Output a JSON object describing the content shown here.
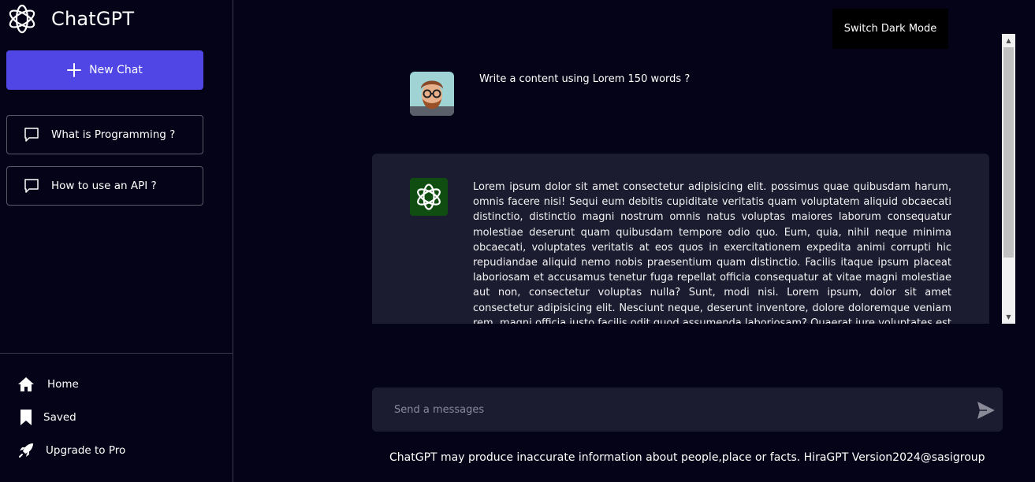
{
  "app": {
    "name": "ChatGPT"
  },
  "sidebar": {
    "new_chat_label": "New Chat",
    "history": [
      {
        "label": "What is Programming ?"
      },
      {
        "label": "How to use an API ?"
      }
    ],
    "nav": [
      {
        "label": "Home",
        "icon": "home-icon"
      },
      {
        "label": "Saved",
        "icon": "bookmark-icon"
      },
      {
        "label": "Upgrade to Pro",
        "icon": "rocket-icon"
      }
    ]
  },
  "header": {
    "dark_mode_label": "Switch Dark Mode"
  },
  "chat": {
    "user_message": "Write a content using Lorem 150 words ?",
    "bot_message": "Lorem ipsum dolor sit amet consectetur adipisicing elit. possimus quae quibusdam harum, omnis facere nisi! Sequi eum debitis cupiditate veritatis quam voluptatem aliquid obcaecati distinctio, distinctio magni nostrum omnis natus voluptas maiores laborum consequatur molestiae deserunt quam quibusdam tempore odio quo. Eum, quia, nihil neque minima obcaecati, voluptates veritatis at eos quos in exercitationem expedita animi corrupti hic repudiandae aliquid nemo nobis praesentium quam distinctio. Facilis itaque ipsum placeat laboriosam et accusamus tenetur fuga repellat officia consequatur at vitae magni molestiae aut non, consectetur voluptas nulla? Sunt, modi nisi. Lorem ipsum, dolor sit amet consectetur adipisicing elit. Nesciunt neque, deserunt inventore, dolore doloremque veniam rem, magni officia iusto facilis odit quod assumenda laboriosam? Quaerat iure voluptates est harum"
  },
  "input": {
    "placeholder": "Send a messages",
    "value": ""
  },
  "footer": {
    "note": "ChatGPT may produce inaccurate information about people,place or facts. HiraGPT Version2024@sasigroup"
  },
  "colors": {
    "background": "#050317",
    "accent": "#4f46e5",
    "panel": "#1c1c31",
    "bot_avatar": "#0f4d10"
  }
}
